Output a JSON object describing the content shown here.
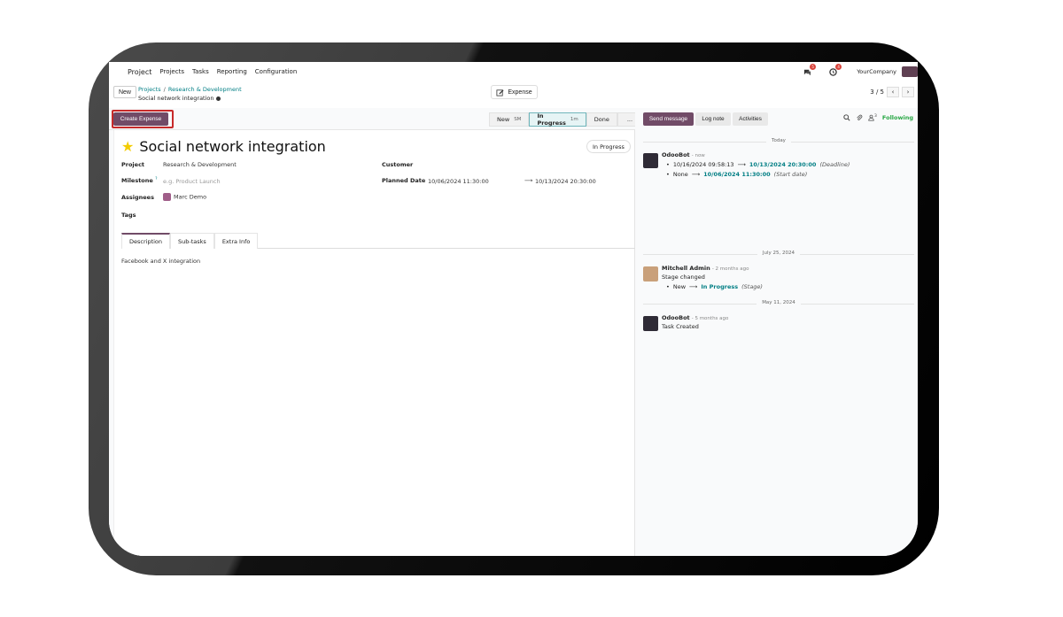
{
  "navbar": {
    "app": "Project",
    "menus": [
      "Projects",
      "Tasks",
      "Reporting",
      "Configuration"
    ],
    "messages_count": "5",
    "activities_count": "4",
    "company": "YourCompany"
  },
  "control_panel": {
    "new_label": "New",
    "breadcrumb_projects": "Projects",
    "breadcrumb_project": "Research & Development",
    "breadcrumb_current": "Social network integration",
    "expense_button": "Expense",
    "pager": "3 / 5"
  },
  "statusbar": {
    "create_expense": "Create Expense",
    "stages": [
      {
        "label": "New",
        "sub": "SM"
      },
      {
        "label": "In Progress",
        "sub": "1m"
      },
      {
        "label": "Done",
        "sub": ""
      },
      {
        "label": "...",
        "sub": ""
      }
    ]
  },
  "form": {
    "title": "Social network integration",
    "state": "In Progress",
    "project_label": "Project",
    "project_value": "Research & Development",
    "milestone_label": "Milestone",
    "milestone_help": "?",
    "milestone_placeholder": "e.g. Product Launch",
    "assignees_label": "Assignees",
    "assignee": "Marc Demo",
    "tags_label": "Tags",
    "customer_label": "Customer",
    "planned_label": "Planned Date",
    "planned_start": "10/06/2024 11:30:00",
    "planned_end": "10/13/2024 20:30:00",
    "tabs": [
      "Description",
      "Sub-tasks",
      "Extra Info"
    ],
    "description": "Facebook and X integration"
  },
  "chatter": {
    "send_message": "Send message",
    "log_note": "Log note",
    "activities": "Activities",
    "followers_count": "3",
    "following": "Following",
    "date_today": "Today",
    "date_july": "July 25, 2024",
    "date_may": "May 11, 2024",
    "msg1": {
      "author": "OdooBot",
      "when": "- now",
      "l1_old": "10/16/2024 09:58:13",
      "l1_new": "10/13/2024 20:30:00",
      "l1_field": "(Deadline)",
      "l2_old": "None",
      "l2_new": "10/06/2024 11:30:00",
      "l2_field": "(Start date)"
    },
    "msg2": {
      "author": "Mitchell Admin",
      "when": "- 2 months ago",
      "text": "Stage changed",
      "old": "New",
      "new": "In Progress",
      "field": "(Stage)"
    },
    "msg3": {
      "author": "OdooBot",
      "when": "- 5 months ago",
      "text": "Task Created"
    }
  }
}
